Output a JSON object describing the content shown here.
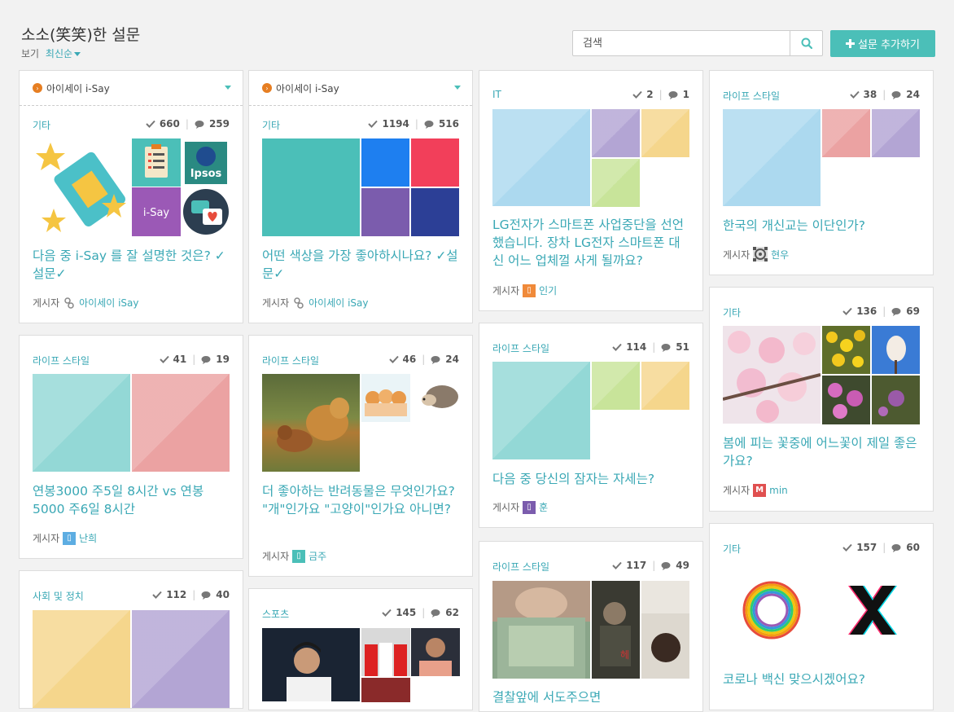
{
  "page": {
    "title": "소소(笑笑)한 설문",
    "view_label": "보기",
    "sort_label": "최신순"
  },
  "search": {
    "placeholder": "검색"
  },
  "add_button": {
    "label": "설문 추가하기"
  },
  "author_label": "게시자",
  "source_name": "아이세이 i-Say",
  "colors": {
    "accent": "#4bbfb8",
    "link": "#3aa8b5"
  },
  "cards": [
    {
      "category": "기타",
      "checks": "660",
      "comments": "259",
      "title": "다음 중 i-Say 를 잘 설명한 것은? ✓설문✓",
      "author": "아이세이 iSay"
    },
    {
      "category": "라이프 스타일",
      "checks": "41",
      "comments": "19",
      "title": "연봉3000 주5일 8시간 vs 연봉 5000 주6일 8시간",
      "author": "난희"
    },
    {
      "category": "사회 및 정치",
      "checks": "112",
      "comments": "40"
    },
    {
      "category": "기타",
      "checks": "1194",
      "comments": "516",
      "title": "어떤 색상을 가장 좋아하시나요? ✓설문✓",
      "author": "아이세이 iSay"
    },
    {
      "category": "라이프 스타일",
      "checks": "46",
      "comments": "24",
      "title": "더 좋아하는 반려동물은 무엇인가요? \"개\"인가요 \"고양이\"인가요 아니면?",
      "author": "금주"
    },
    {
      "category": "스포츠",
      "checks": "145",
      "comments": "62"
    },
    {
      "category": "IT",
      "checks": "2",
      "comments": "1",
      "title": "LG전자가 스마트폰 사업중단을 선언했습니다. 장차 LG전자 스마트폰 대신 어느 업체껄 사게 될까요?",
      "author": "인기"
    },
    {
      "category": "라이프 스타일",
      "checks": "114",
      "comments": "51",
      "title": "다음 중 당신의 잠자는 자세는?",
      "author": "훈"
    },
    {
      "category": "라이프 스타일",
      "checks": "117",
      "comments": "49",
      "title": "결찰앞에 서도주으면"
    },
    {
      "category": "라이프 스타일",
      "checks": "38",
      "comments": "24",
      "title": "한국의 개신교는 이단인가?",
      "author": "현우"
    },
    {
      "category": "기타",
      "checks": "136",
      "comments": "69",
      "title": "봄에 피는 꽃중에 어느꽃이 제일 좋은가요?",
      "author": "min"
    },
    {
      "category": "기타",
      "checks": "157",
      "comments": "60",
      "title": "코로나 백신 맞으시겠어요?"
    }
  ]
}
